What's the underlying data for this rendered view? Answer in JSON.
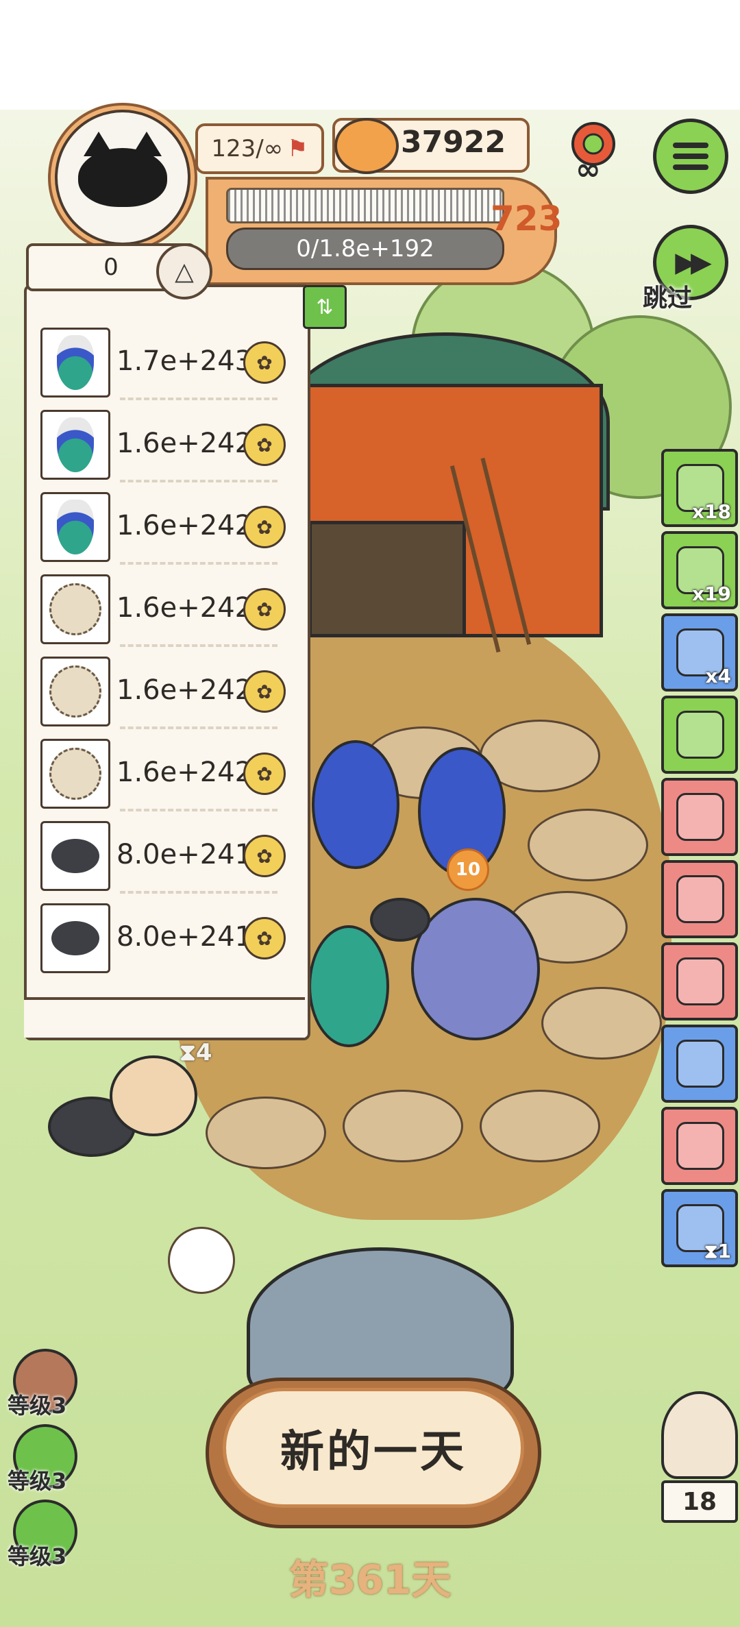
{
  "header": {
    "level_progress": "123/∞",
    "coins": "37922",
    "player_level": "723",
    "xp": "0/1.8e+192",
    "emblem_text": "∞",
    "skip_label": "跳过"
  },
  "list_panel": {
    "count": "0",
    "rows": [
      {
        "animal": "peacock",
        "value": "1.7e+243"
      },
      {
        "animal": "peacock",
        "value": "1.6e+242"
      },
      {
        "animal": "peacock",
        "value": "1.6e+242"
      },
      {
        "animal": "hedgehog",
        "value": "1.6e+242"
      },
      {
        "animal": "hedgehog",
        "value": "1.6e+242"
      },
      {
        "animal": "hedgehog",
        "value": "1.6e+242"
      },
      {
        "animal": "mole",
        "value": "8.0e+241"
      },
      {
        "animal": "mole",
        "value": "8.0e+241"
      }
    ]
  },
  "right_items": [
    {
      "name": "worms",
      "count": "x18",
      "color": "#8bd153"
    },
    {
      "name": "tent",
      "count": "x19",
      "color": "#8bd153"
    },
    {
      "name": "bread",
      "count": "x4",
      "color": "#6b9ee8"
    },
    {
      "name": "card",
      "count": "",
      "color": "#8bd153"
    },
    {
      "name": "ball",
      "count": "",
      "color": "#ee8a86"
    },
    {
      "name": "feather",
      "count": "",
      "color": "#ee8a86"
    },
    {
      "name": "bracelet",
      "count": "",
      "color": "#ee8a86"
    },
    {
      "name": "trophy",
      "count": "",
      "color": "#6b9ee8"
    },
    {
      "name": "scarf",
      "count": "",
      "color": "#ee8a86"
    },
    {
      "name": "shovel",
      "count": "1",
      "color": "#6b9ee8"
    }
  ],
  "field": {
    "badge": "10",
    "timer": "4"
  },
  "bottom": {
    "new_day_label": "新的一天",
    "day_label": "第361天",
    "owl_count": "18",
    "levels": [
      {
        "label": "等级3",
        "color": "#b5785a"
      },
      {
        "label": "等级3",
        "color": "#6ec24b"
      },
      {
        "label": "等级3",
        "color": "#6ec24b"
      }
    ]
  }
}
